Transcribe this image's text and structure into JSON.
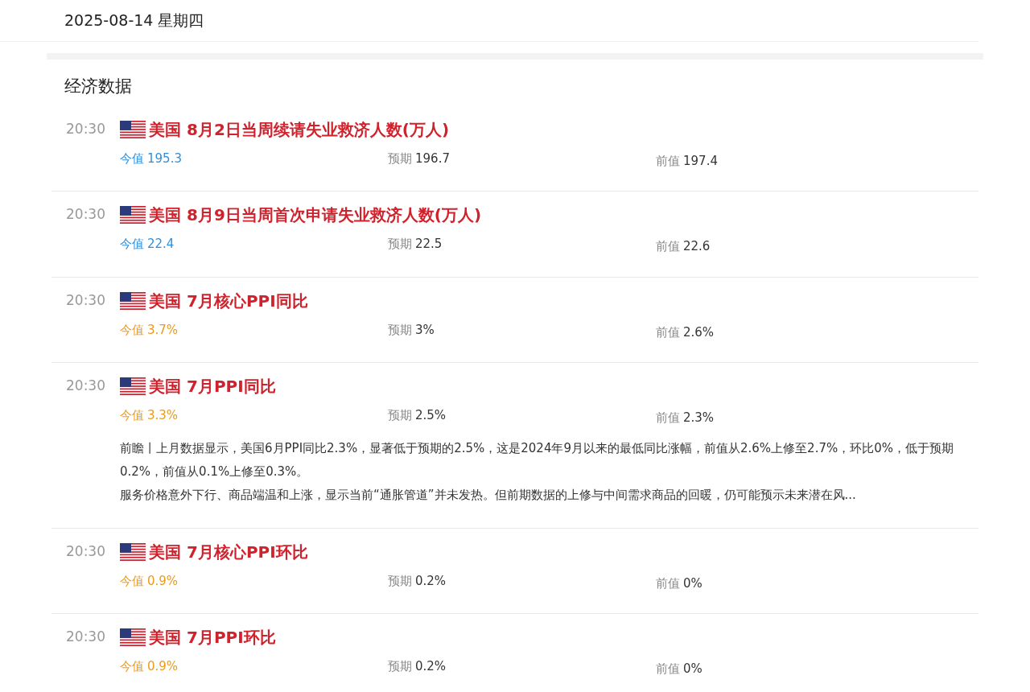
{
  "date": "2025-08-14 星期四",
  "section_title": "经济数据",
  "events": [
    {
      "time": "20:30",
      "title": "美国 8月2日当周续请失业救济人数(万人)",
      "actual_label": "今值",
      "actual": "195.3",
      "color": "#2f8fdc",
      "forecast_label": "预期",
      "forecast": "196.7",
      "previous_label": "前值",
      "previous": "197.4"
    },
    {
      "time": "20:30",
      "title": "美国 8月9日当周首次申请失业救济人数(万人)",
      "actual_label": "今值",
      "actual": "22.4",
      "color": "#2f8fdc",
      "forecast_label": "预期",
      "forecast": "22.5",
      "previous_label": "前值",
      "previous": "22.6"
    },
    {
      "time": "20:30",
      "title": "美国 7月核心PPI同比",
      "actual_label": "今值",
      "actual": "3.7%",
      "color": "#ec9a1e",
      "forecast_label": "预期",
      "forecast": "3%",
      "previous_label": "前值",
      "previous": "2.6%"
    },
    {
      "time": "20:30",
      "title": "美国 7月PPI同比",
      "actual_label": "今值",
      "actual": "3.3%",
      "color": "#ec9a1e",
      "forecast_label": "预期",
      "forecast": "2.5%",
      "previous_label": "前值",
      "previous": "2.3%",
      "notes": [
        "前瞻丨上月数据显示，美国6月PPI同比2.3%，显著低于预期的2.5%，这是2024年9月以来的最低同比涨幅，前值从2.6%上修至2.7%，环比0%，低于预期0.2%，前值从0.1%上修至0.3%。",
        "服务价格意外下行、商品端温和上涨，显示当前“通胀管道”并未发热。但前期数据的上修与中间需求商品的回暖，仍可能预示未来潜在风..."
      ]
    },
    {
      "time": "20:30",
      "title": "美国 7月核心PPI环比",
      "actual_label": "今值",
      "actual": "0.9%",
      "color": "#ec9a1e",
      "forecast_label": "预期",
      "forecast": "0.2%",
      "previous_label": "前值",
      "previous": "0%"
    },
    {
      "time": "20:30",
      "title": "美国 7月PPI环比",
      "actual_label": "今值",
      "actual": "0.9%",
      "color": "#ec9a1e",
      "forecast_label": "预期",
      "forecast": "0.2%",
      "previous_label": "前值",
      "previous": "0%"
    }
  ]
}
